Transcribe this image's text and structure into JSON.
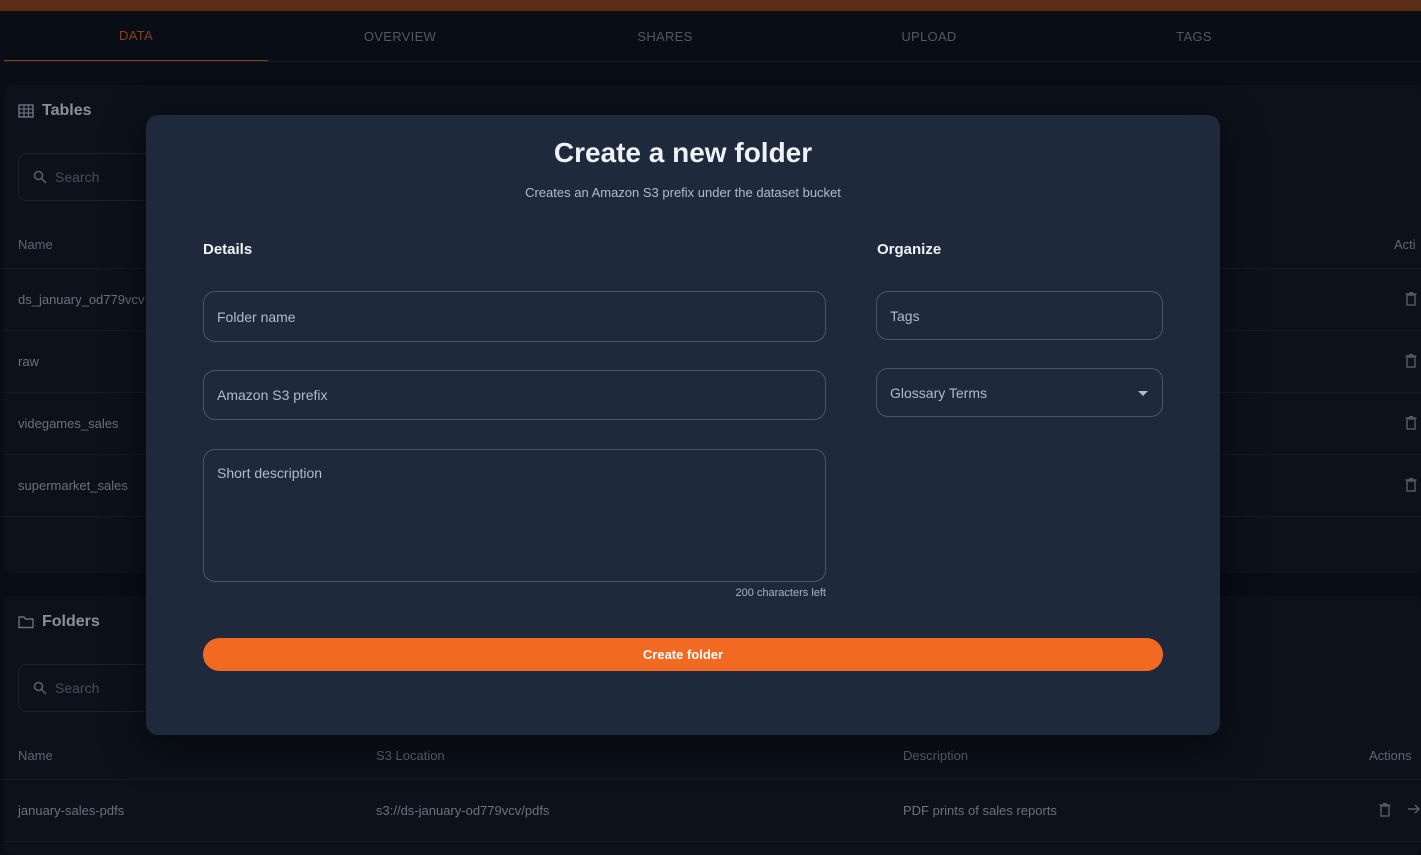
{
  "tabs": [
    "DATA",
    "OVERVIEW",
    "SHARES",
    "UPLOAD",
    "TAGS"
  ],
  "tables_card": {
    "title": "Tables",
    "search_placeholder": "Search",
    "columns": {
      "name": "Name",
      "actions": "Acti"
    },
    "rows": [
      "ds_january_od779vcv",
      "raw",
      "videgames_sales",
      "supermarket_sales"
    ]
  },
  "folders_card": {
    "title": "Folders",
    "search_placeholder": "Search",
    "columns": {
      "name": "Name",
      "location": "S3 Location",
      "description": "Description",
      "actions": "Actions"
    },
    "rows": [
      {
        "name": "january-sales-pdfs",
        "location": "s3://ds-january-od779vcv/pdfs",
        "description": "PDF prints of sales reports"
      }
    ]
  },
  "modal": {
    "title": "Create a new folder",
    "subtitle": "Creates an Amazon S3 prefix under the dataset bucket",
    "details_heading": "Details",
    "organize_heading": "Organize",
    "folder_name_placeholder": "Folder name",
    "s3_prefix_placeholder": "Amazon S3 prefix",
    "description_placeholder": "Short description",
    "chars_left": "200 characters left",
    "tags_placeholder": "Tags",
    "glossary_placeholder": "Glossary Terms",
    "submit_label": "Create folder"
  },
  "colors": {
    "accent": "#f26a22",
    "modal_bg": "#1e293b",
    "page_bg": "#0b0f19"
  }
}
